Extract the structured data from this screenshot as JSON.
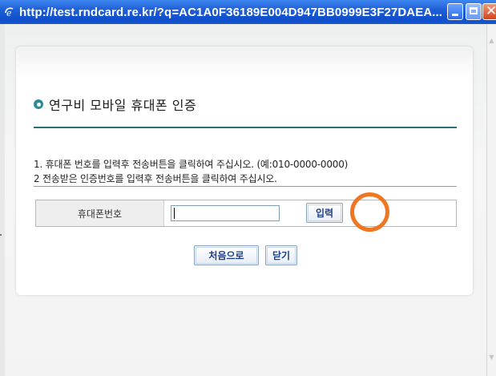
{
  "window": {
    "title": "http://test.rndcard.re.kr/?q=AC1A0F36189E004D947BB0999E3F27DAEA...",
    "icon": "ie-icon",
    "controls": [
      "minimize-icon",
      "maximize-icon",
      "close-icon"
    ]
  },
  "page": {
    "heading": "연구비 모바일 휴대폰 인증",
    "instructions": [
      "1. 휴대폰 번호를 입력후 전송버튼을 클릭하여 주십시오. (예:010-0000-0000)",
      "2 전송받은 인증번호를 입력후 전송버튼을 클릭하여 주십시오."
    ],
    "form": {
      "phone_label": "휴대폰번호",
      "phone_value": "",
      "submit_label": "입력"
    },
    "actions": {
      "restart_label": "처음으로",
      "close_label": "닫기"
    }
  },
  "colors": {
    "titlebar": "#0f4fcb",
    "accent_rule": "#2b6f78",
    "annotation_circle": "#ef7722"
  }
}
